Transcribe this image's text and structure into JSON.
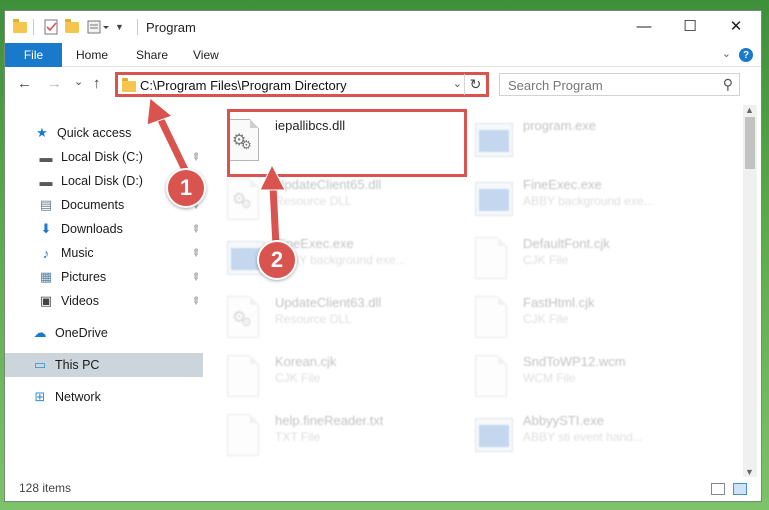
{
  "window": {
    "title": "Program",
    "controls": {
      "minimize": "—",
      "maximize": "☐",
      "close": "✕"
    }
  },
  "ribbon": {
    "file_tab": "File",
    "tabs": [
      "Home",
      "Share",
      "View"
    ],
    "expand_icon": "chevron-down-icon",
    "help_label": "?"
  },
  "navigation": {
    "back_icon": "←",
    "forward_icon": "→",
    "recent_icon": "⌄",
    "up_icon": "↑",
    "address_path": "C:\\Program Files\\Program Directory",
    "address_dropdown_icon": "⌄",
    "refresh_icon": "↻",
    "search_placeholder": "Search Program",
    "search_icon": "⚲"
  },
  "sidebar": {
    "items": [
      {
        "label": "Quick access",
        "icon": "★",
        "icon_color": "#1979ca",
        "pinned": false
      },
      {
        "label": "Local Disk (C:)",
        "icon": "▬",
        "icon_color": "#5a5a5a",
        "pinned": true
      },
      {
        "label": "Local Disk (D:)",
        "icon": "▬",
        "icon_color": "#5a5a5a",
        "pinned": true
      },
      {
        "label": "Documents",
        "icon": "▤",
        "icon_color": "#6b7b8b",
        "pinned": true
      },
      {
        "label": "Downloads",
        "icon": "⬇",
        "icon_color": "#1979ca",
        "pinned": true
      },
      {
        "label": "Music",
        "icon": "♪",
        "icon_color": "#1979ca",
        "pinned": true
      },
      {
        "label": "Pictures",
        "icon": "▦",
        "icon_color": "#5a7fa0",
        "pinned": true
      },
      {
        "label": "Videos",
        "icon": "▣",
        "icon_color": "#444",
        "pinned": true
      },
      {
        "label": "OneDrive",
        "icon": "☁",
        "icon_color": "#1979ca",
        "pinned": false
      },
      {
        "label": "This PC",
        "icon": "▭",
        "icon_color": "#2a8fd6",
        "pinned": false,
        "selected": true
      },
      {
        "label": "Network",
        "icon": "⊞",
        "icon_color": "#2a8fd6",
        "pinned": false
      }
    ],
    "pin_icon": "📌"
  },
  "files": [
    {
      "name": "iepallibcs.dll",
      "type": "",
      "icon": "dll",
      "faded": false
    },
    {
      "name": "program.exe",
      "type": "",
      "icon": "exe",
      "faded": true
    },
    {
      "name": "UpdateClient65.dll",
      "type": "Resource DLL",
      "icon": "dll",
      "faded": true
    },
    {
      "name": "FineExec.exe",
      "type": "ABBY background exe...",
      "icon": "exe",
      "faded": true
    },
    {
      "name": "FineExec.exe",
      "type": "ABBY background exe...",
      "icon": "exe",
      "faded": true
    },
    {
      "name": "DefaultFont.cjk",
      "type": "CJK File",
      "icon": "doc",
      "faded": true
    },
    {
      "name": "UpdateClient63.dll",
      "type": "Resource DLL",
      "icon": "dll",
      "faded": true
    },
    {
      "name": "FastHtml.cjk",
      "type": "CJK File",
      "icon": "doc",
      "faded": true
    },
    {
      "name": "Korean.cjk",
      "type": "CJK File",
      "icon": "doc",
      "faded": true
    },
    {
      "name": "SndToWP12.wcm",
      "type": "WCM File",
      "icon": "doc",
      "faded": true
    },
    {
      "name": "help.fineReader.txt",
      "type": "TXT File",
      "icon": "doc",
      "faded": true
    },
    {
      "name": "AbbyySTI.exe",
      "type": "ABBY sti event hand...",
      "icon": "exe",
      "faded": true
    }
  ],
  "status": {
    "item_count": "128 items"
  },
  "annotations": {
    "badge_1": "1",
    "badge_2": "2",
    "color": "#d9534f"
  }
}
